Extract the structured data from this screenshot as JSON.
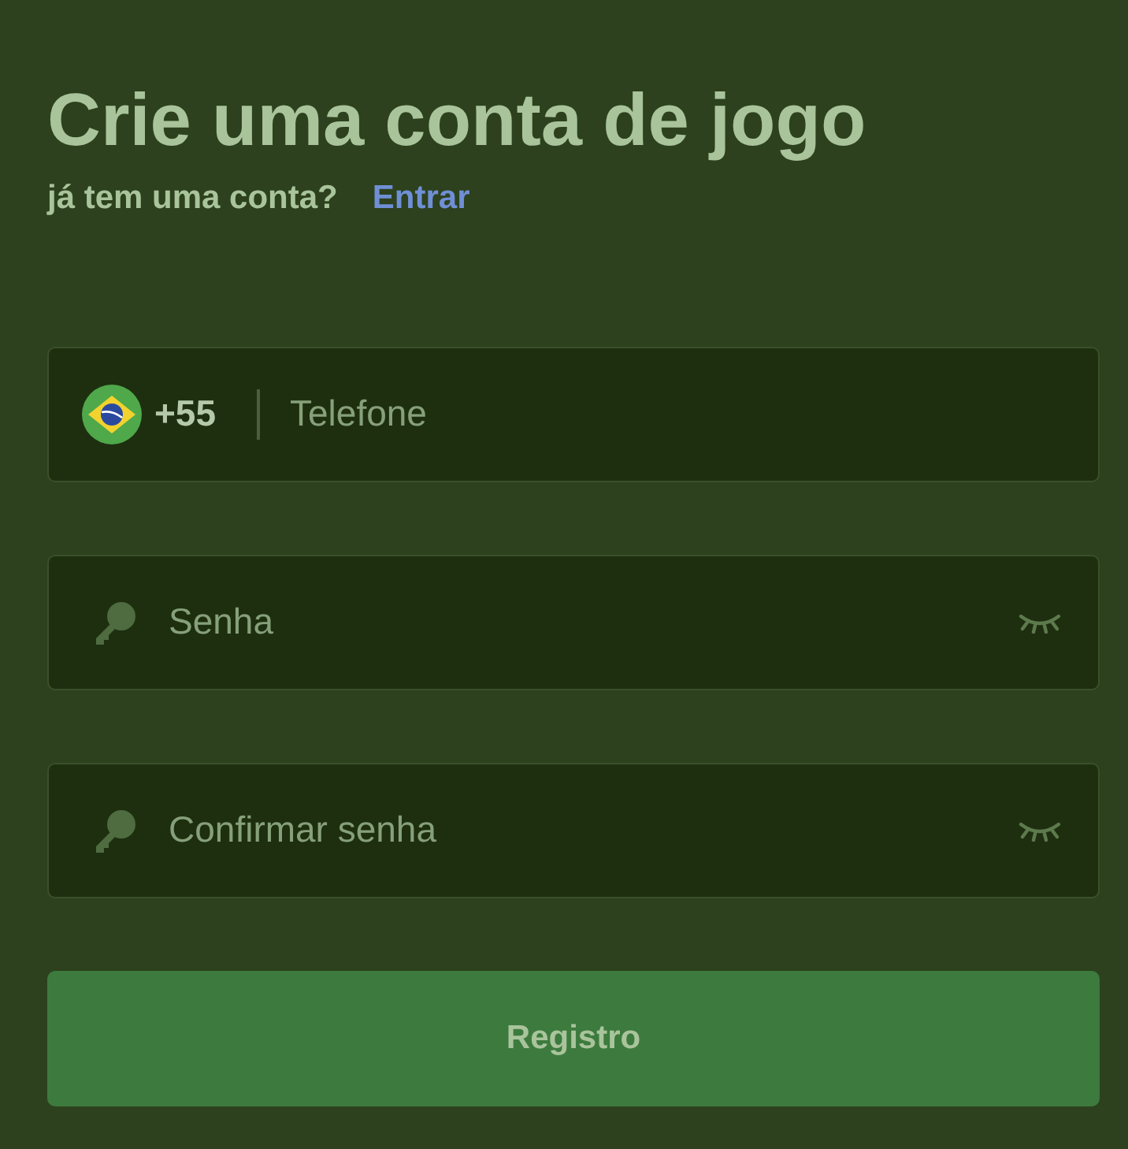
{
  "heading": "Crie uma conta de jogo",
  "login_prompt": {
    "text": "já tem uma conta?",
    "link": "Entrar"
  },
  "fields": [
    {
      "kind": "phone",
      "country_code": "+55",
      "placeholder": "Telefone"
    },
    {
      "kind": "password",
      "placeholder": "Senha"
    },
    {
      "kind": "password",
      "placeholder": "Confirmar senha"
    }
  ],
  "submit_button": {
    "label": "Registro",
    "disabled": true
  }
}
